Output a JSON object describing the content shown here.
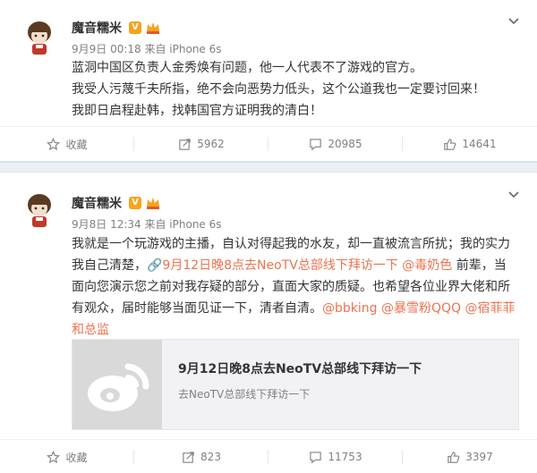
{
  "posts": [
    {
      "user": "魔音糯米",
      "badge": "V",
      "meta": "9月9日 00:18 来自 iPhone 6s",
      "lines": [
        [
          {
            "t": "蓝洞中国区负责人金秀焕有问题，他一人代表不了游戏的官方。"
          }
        ],
        [
          {
            "t": "我受人污蔑千夫所指，绝不会向恶势力低头，这个公道我也一定要讨回来！"
          }
        ],
        [
          {
            "t": "我即日启程赴韩，找韩国官方证明我的清白！"
          }
        ]
      ],
      "actions": {
        "favorite": "收藏",
        "repost": "5962",
        "comment": "20985",
        "like": "14641"
      }
    },
    {
      "user": "魔音糯米",
      "badge": "V",
      "meta": "9月8日 12:34 来自 iPhone 6s",
      "lines": [
        [
          {
            "t": "我就是一个玩游戏的主播，自认对得起我的水友，却一直被流言所扰；我的实力"
          }
        ],
        [
          {
            "t": "我自己清楚，"
          },
          {
            "t": "🔗9月12日晚8点去NeoTV总部线下拜访一下",
            "link": true
          },
          {
            "t": " "
          },
          {
            "t": "@毒奶色",
            "link": true
          },
          {
            "t": " 前辈，当"
          }
        ],
        [
          {
            "t": "面向您演示您之前对我存疑的部分，直面大家的质疑。也希望各位业界大佬和所"
          }
        ],
        [
          {
            "t": "有观众，届时能够当面见证一下，清者自清。"
          },
          {
            "t": "@bbking",
            "link": true
          },
          {
            "t": " "
          },
          {
            "t": "@暴雪粉QQQ",
            "link": true
          },
          {
            "t": " "
          },
          {
            "t": "@宿菲菲",
            "link": true
          }
        ],
        [
          {
            "t": "和总监",
            "link": true
          }
        ]
      ],
      "link_card": {
        "title": "9月12日晚8点去NeoTV总部线下拜访一下",
        "subtitle": "去NeoTV总部线下拜访一下"
      },
      "actions": {
        "favorite": "收藏",
        "repost": "823",
        "comment": "11753",
        "like": "3397"
      }
    }
  ],
  "colors": {
    "link": "#eb7350",
    "badge": "#f8a31b",
    "meta": "#808080"
  },
  "icons": [
    "avatar",
    "verified-badge",
    "crown-badge",
    "chevron-down-icon",
    "star-icon",
    "repost-icon",
    "comment-icon",
    "like-icon",
    "weibo-logo-icon"
  ]
}
